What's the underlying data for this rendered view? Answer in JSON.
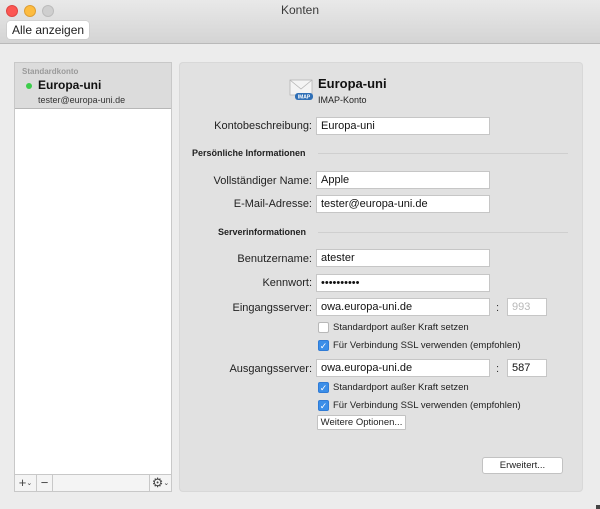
{
  "window": {
    "title": "Konten",
    "show_all_label": "Alle anzeigen"
  },
  "sidebar": {
    "group_label": "Standardkonto",
    "accounts": [
      {
        "name": "Europa-uni",
        "email": "tester@europa-uni.de",
        "status_color": "#3ccd4b"
      }
    ],
    "toolbar": {
      "add_icon": "+",
      "add_chevron": "⌄",
      "remove_icon": "−",
      "gear_icon": "⚙",
      "gear_chevron": "⌄"
    }
  },
  "account_header": {
    "name": "Europa-uni",
    "type": "IMAP-Konto",
    "icon_badge": "IMAP"
  },
  "form": {
    "description_label": "Kontobeschreibung:",
    "description_value": "Europa-uni",
    "personal_section": "Persönliche Informationen",
    "full_name_label": "Vollständiger Name:",
    "full_name_value": "Apple",
    "email_label": "E-Mail-Adresse:",
    "email_value": "tester@europa-uni.de",
    "server_section": "Serverinformationen",
    "username_label": "Benutzername:",
    "username_value": "atester",
    "password_label": "Kennwort:",
    "password_value": "••••••••••",
    "incoming_label": "Eingangsserver:",
    "incoming_value": "owa.europa-uni.de",
    "incoming_port": "993",
    "incoming_override_label": "Standardport außer Kraft setzen",
    "incoming_override_checked": false,
    "incoming_ssl_label": "Für Verbindung SSL verwenden (empfohlen)",
    "incoming_ssl_checked": true,
    "outgoing_label": "Ausgangsserver:",
    "outgoing_value": "owa.europa-uni.de",
    "outgoing_port": "587",
    "outgoing_override_label": "Standardport außer Kraft setzen",
    "outgoing_override_checked": true,
    "outgoing_ssl_label": "Für Verbindung SSL verwenden (empfohlen)",
    "outgoing_ssl_checked": true,
    "more_options_label": "Weitere Optionen...",
    "port_separator": ":",
    "check_mark": "✓"
  },
  "advanced_button_label": "Erweitert..."
}
